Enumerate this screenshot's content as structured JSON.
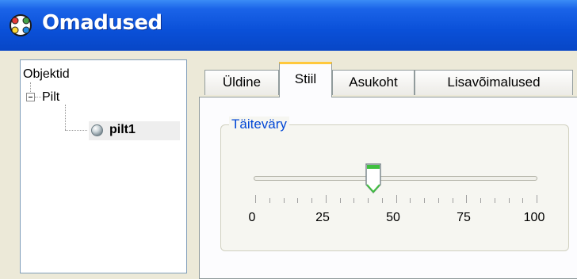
{
  "window": {
    "title": "Omadused",
    "icon": "properties-gear-icon"
  },
  "tree": {
    "root_label": "Objektid",
    "group_label": "Pilt",
    "leaf_label": "pilt1",
    "leaf_icon": "sphere-icon"
  },
  "tabs": [
    {
      "label": "Üldine"
    },
    {
      "label": "Stiil"
    },
    {
      "label": "Asukoht"
    },
    {
      "label": "Lisavõimalused"
    }
  ],
  "active_tab": "Stiil",
  "fill_group": {
    "title": "Täiteväry",
    "slider_min": 0,
    "slider_max": 100,
    "slider_value": 42,
    "tick_labels": [
      "0",
      "25",
      "50",
      "75",
      "100"
    ]
  },
  "colors": {
    "titlebar": "#0a50d8",
    "active_tab_accent": "#ffc83c",
    "group_title": "#0046d5",
    "slider_thumb_fill": "#3fbf3f"
  }
}
